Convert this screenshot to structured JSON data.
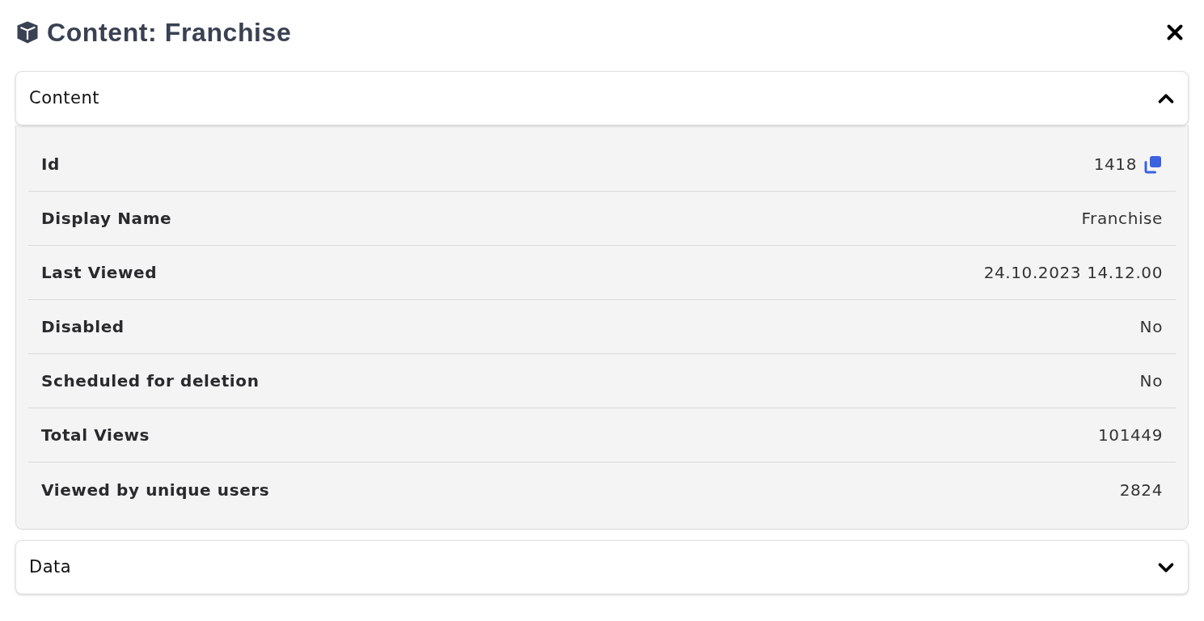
{
  "dialog": {
    "title": "Content: Franchise"
  },
  "sections": [
    {
      "title": "Content",
      "expanded": true,
      "rows": [
        {
          "label": "Id",
          "value": "1418",
          "copyable": true
        },
        {
          "label": "Display Name",
          "value": "Franchise",
          "copyable": false
        },
        {
          "label": "Last Viewed",
          "value": "24.10.2023 14.12.00",
          "copyable": false
        },
        {
          "label": "Disabled",
          "value": "No",
          "copyable": false
        },
        {
          "label": "Scheduled for deletion",
          "value": "No",
          "copyable": false
        },
        {
          "label": "Total Views",
          "value": "101449",
          "copyable": false
        },
        {
          "label": "Viewed by unique users",
          "value": "2824",
          "copyable": false
        }
      ]
    },
    {
      "title": "Data",
      "expanded": false
    }
  ]
}
